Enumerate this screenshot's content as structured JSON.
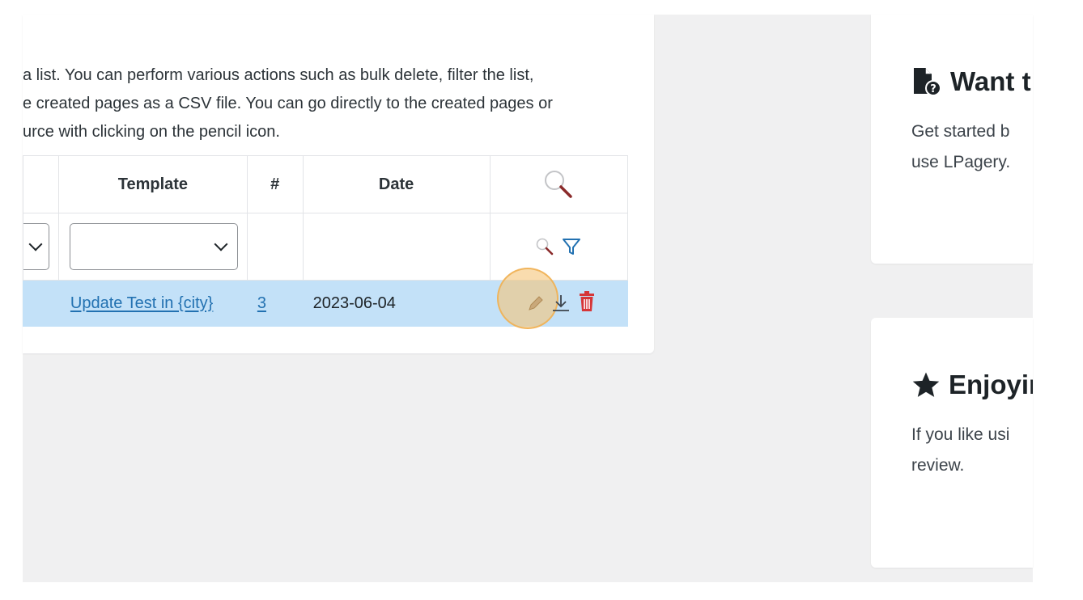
{
  "intro": {
    "line1": "a list. You can perform various actions such as bulk delete, filter the list,",
    "line2": "e created pages as a CSV file. You can go directly to the created pages or",
    "line3": "urce with clicking on the pencil icon."
  },
  "table": {
    "headers": {
      "template": "Template",
      "count": "#",
      "date": "Date"
    },
    "row": {
      "template": "Update Test in {city}",
      "count": "3",
      "date": "2023-06-04"
    },
    "icons": {
      "header_search": "search-icon",
      "filter_search": "search-icon",
      "filter": "filter-icon",
      "edit": "pencil-icon",
      "download": "download-icon",
      "delete": "trash-icon"
    }
  },
  "sidebar": {
    "card1": {
      "icon": "file-question-icon",
      "title": "Want t",
      "line1": "Get started b",
      "line2": "use LPagery."
    },
    "card2": {
      "icon": "star-icon",
      "title": "Enjoyin",
      "line1": "If you like usi",
      "line2": "review."
    }
  },
  "colors": {
    "accent": "#2271b1",
    "row_highlight": "#c3e1f8",
    "delete": "#d63638",
    "click_ring": "#f0af50"
  }
}
